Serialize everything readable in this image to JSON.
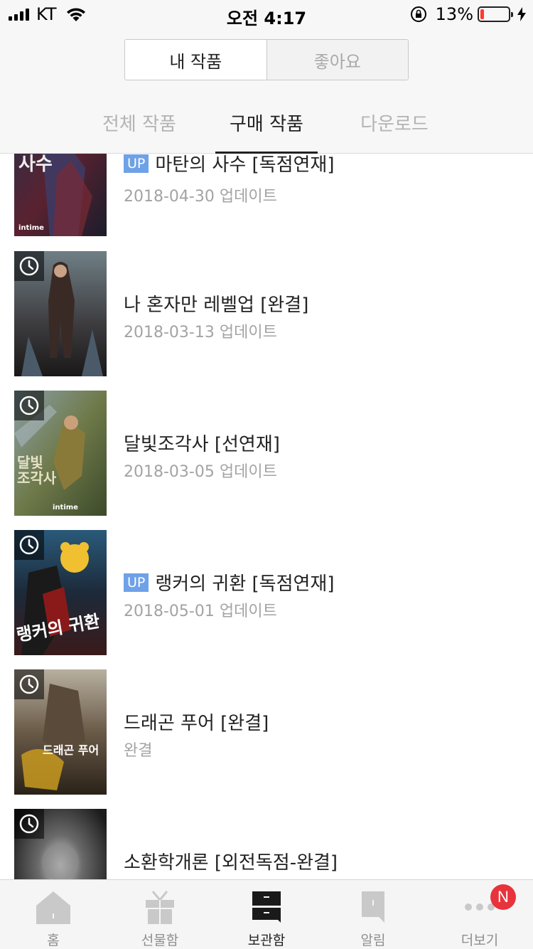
{
  "status": {
    "carrier": "KT",
    "time": "오전 4:17",
    "battery_percent": "13%",
    "battery_level": 0.13,
    "battery_color": "#ff3b30"
  },
  "header": {
    "segment": {
      "mine_label": "내 작품",
      "likes_label": "좋아요"
    },
    "tabs": [
      {
        "label": "전체 작품"
      },
      {
        "label": "구매 작품"
      },
      {
        "label": "다운로드"
      }
    ],
    "active_tab": "구매 작품"
  },
  "works": [
    {
      "badge": "UP",
      "title": "마탄의 사수 [독점연재]",
      "updated": "2018-04-30 업데이트",
      "cover_label": "intime",
      "cover_text": "사수"
    },
    {
      "title": "나 혼자만 레벨업 [완결]",
      "updated": "2018-03-13 업데이트"
    },
    {
      "title": "달빛조각사 [선연재]",
      "updated": "2018-03-05 업데이트",
      "cover_label": "intime",
      "cover_text": "달빛 조각사"
    },
    {
      "badge": "UP",
      "title": "랭커의 귀환 [독점연재]",
      "updated": "2018-05-01 업데이트",
      "cover_text": "랭커의 귀환"
    },
    {
      "title": "드래곤 푸어 [완결]",
      "updated": "완결",
      "cover_text": "드래곤 푸어"
    },
    {
      "title": "소환학개론 [외전독점-완결]"
    }
  ],
  "tabbar": {
    "items": [
      {
        "label": "홈",
        "icon": "home-icon"
      },
      {
        "label": "선물함",
        "icon": "gift-icon"
      },
      {
        "label": "보관함",
        "icon": "storage-icon"
      },
      {
        "label": "알림",
        "icon": "notification-icon"
      },
      {
        "label": "더보기",
        "icon": "more-icon"
      }
    ],
    "active": "보관함",
    "notification_badge": "N"
  },
  "colors": {
    "accent_badge": "#6ea1e8",
    "notification_red": "#e8323c"
  }
}
